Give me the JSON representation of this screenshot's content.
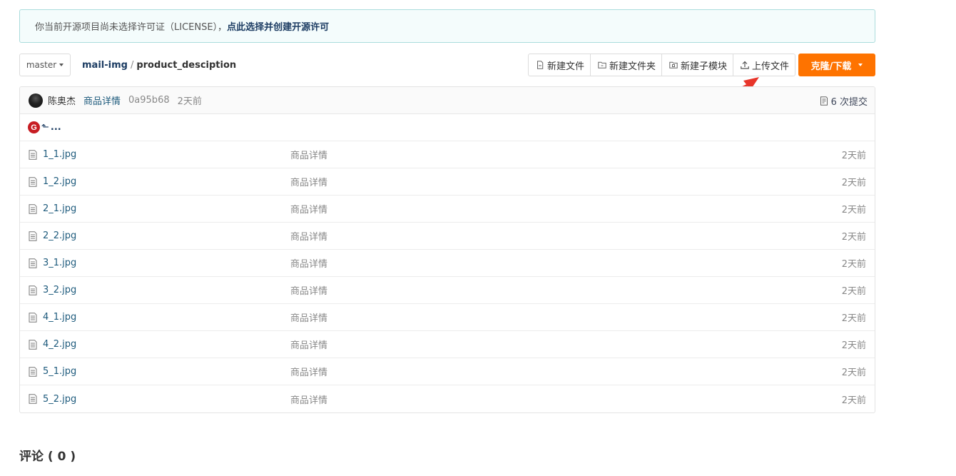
{
  "notice": {
    "text": "你当前开源项目尚未选择许可证（LICENSE），",
    "link": "点此选择并创建开源许可"
  },
  "toolbar": {
    "branch": "master",
    "repo": "mail-img",
    "separator": "/",
    "dir": "product_desciption",
    "buttons": {
      "new_file": "新建文件",
      "new_folder": "新建文件夹",
      "new_submodule": "新建子模块",
      "upload": "上传文件"
    },
    "clone": "克隆/下载"
  },
  "commit": {
    "author": "陈奥杰",
    "message": "商品详情",
    "sha": "0a95b68",
    "time": "2天前",
    "count": "6 次提交"
  },
  "parent": {
    "dots": "..."
  },
  "files": [
    {
      "name": "1_1.jpg",
      "message": "商品详情",
      "time": "2天前"
    },
    {
      "name": "1_2.jpg",
      "message": "商品详情",
      "time": "2天前"
    },
    {
      "name": "2_1.jpg",
      "message": "商品详情",
      "time": "2天前"
    },
    {
      "name": "2_2.jpg",
      "message": "商品详情",
      "time": "2天前"
    },
    {
      "name": "3_1.jpg",
      "message": "商品详情",
      "time": "2天前"
    },
    {
      "name": "3_2.jpg",
      "message": "商品详情",
      "time": "2天前"
    },
    {
      "name": "4_1.jpg",
      "message": "商品详情",
      "time": "2天前"
    },
    {
      "name": "4_2.jpg",
      "message": "商品详情",
      "time": "2天前"
    },
    {
      "name": "5_1.jpg",
      "message": "商品详情",
      "time": "2天前"
    },
    {
      "name": "5_2.jpg",
      "message": "商品详情",
      "time": "2天前"
    }
  ],
  "comments_title": "评论 ( 0 )",
  "colors": {
    "accent": "#fe7300",
    "link": "#1d5a7c",
    "annotation_arrow": "#e8352a"
  },
  "icons": [
    "file-icon",
    "folder-icon",
    "submodule-icon",
    "upload-icon",
    "commits-icon",
    "gitee-logo-icon",
    "back-arrow-icon"
  ]
}
